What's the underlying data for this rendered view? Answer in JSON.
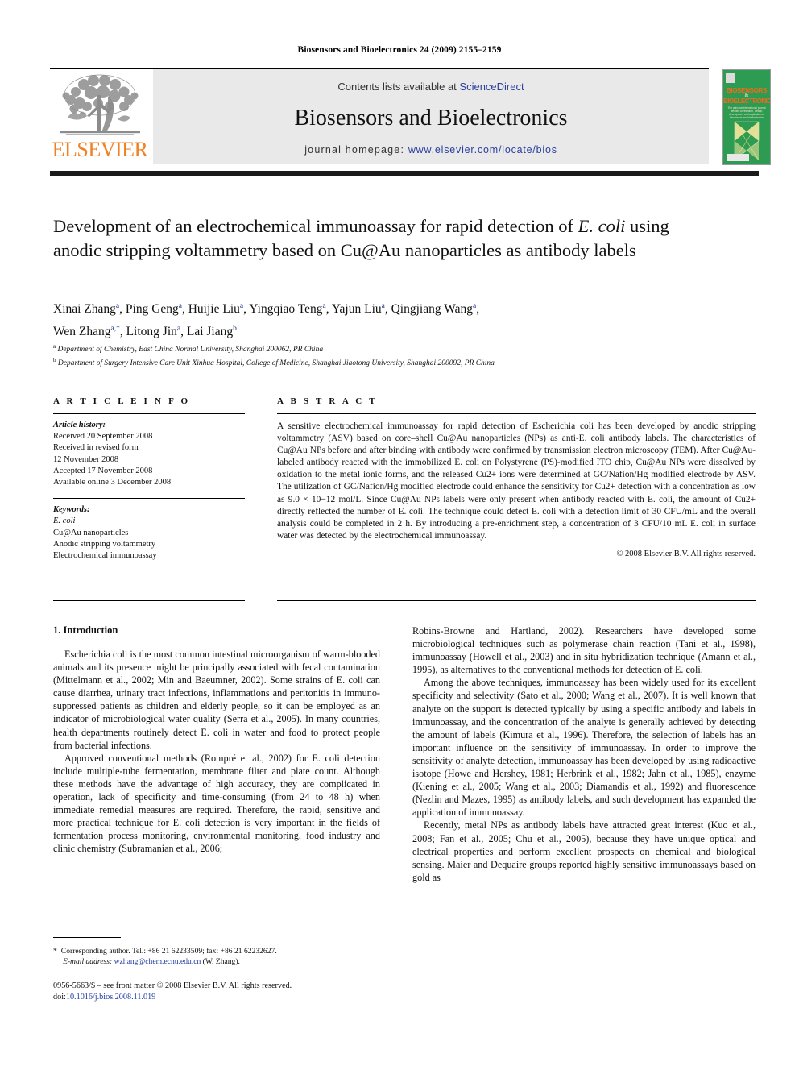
{
  "running_head": "Biosensors and Bioelectronics 24 (2009) 2155–2159",
  "journal_header": {
    "contents_prefix": "Contents lists available at ",
    "sciencedirect": "ScienceDirect",
    "journal_name": "Biosensors and Bioelectronics",
    "homepage_label": "journal homepage:",
    "homepage_url": "www.elsevier.com/locate/bios",
    "publisher_logo_text": "ELSEVIER",
    "cover": {
      "line1": "BIOSENSORS",
      "amp": "&",
      "line2": "BIOELECTRONICS",
      "subtitle": "The principal international journal devoted to research, design, development and application of biosensors and bioelectronics"
    },
    "accent_orange": "#f08020",
    "accent_blue": "#2b3f9e",
    "cover_green": "#2e9b52"
  },
  "article": {
    "title_line1": "Development of an electrochemical immunoassay for rapid detection of",
    "title_italic": "E. coli",
    "title_line2_rest": " using anodic stripping voltammetry based on Cu@Au nanoparticles",
    "title_line3": "as antibody labels",
    "authors": "Xinai Zhang, Ping Geng, Huijie Liu, Yingqiao Teng, Yajun Liu, Qingjiang Wang, Wen Zhang, Litong Jin, Lai Jiang",
    "author_list": [
      {
        "name": "Xinai Zhang",
        "sup": "a"
      },
      {
        "name": "Ping Geng",
        "sup": "a"
      },
      {
        "name": "Huijie Liu",
        "sup": "a"
      },
      {
        "name": "Yingqiao Teng",
        "sup": "a"
      },
      {
        "name": "Yajun Liu",
        "sup": "a"
      },
      {
        "name": "Qingjiang Wang",
        "sup": "a"
      },
      {
        "name": "Wen Zhang",
        "sup": "a,*"
      },
      {
        "name": "Litong Jin",
        "sup": "a"
      },
      {
        "name": "Lai Jiang",
        "sup": "b"
      }
    ],
    "affiliations": [
      {
        "mark": "a",
        "text": "Department of Chemistry, East China Normal University, Shanghai 200062, PR China"
      },
      {
        "mark": "b",
        "text": "Department of Surgery Intensive Care Unit Xinhua Hospital, College of Medicine, Shanghai Jiaotong University, Shanghai 200092, PR China"
      }
    ]
  },
  "article_info": {
    "heading": "A R T I C L E    I N F O",
    "history_label": "Article history:",
    "history_lines": [
      "Received 20 September 2008",
      "Received in revised form",
      "12 November 2008",
      "Accepted 17 November 2008",
      "Available online 3 December 2008"
    ],
    "keywords_label": "Keywords:",
    "keywords": [
      "E. coli",
      "Cu@Au nanoparticles",
      "Anodic stripping voltammetry",
      "Electrochemical immunoassay"
    ]
  },
  "abstract": {
    "heading": "A B S T R A C T",
    "text": "A sensitive electrochemical immunoassay for rapid detection of Escherichia coli has been developed by anodic stripping voltammetry (ASV) based on core–shell Cu@Au nanoparticles (NPs) as anti-E. coli antibody labels. The characteristics of Cu@Au NPs before and after binding with antibody were confirmed by transmission electron microscopy (TEM). After Cu@Au-labeled antibody reacted with the immobilized E. coli on Polystyrene (PS)-modified ITO chip, Cu@Au NPs were dissolved by oxidation to the metal ionic forms, and the released Cu2+ ions were determined at GC/Nafion/Hg modified electrode by ASV. The utilization of GC/Nafion/Hg modified electrode could enhance the sensitivity for Cu2+ detection with a concentration as low as 9.0 × 10−12 mol/L. Since Cu@Au NPs labels were only present when antibody reacted with E. coli, the amount of Cu2+ directly reflected the number of E. coli. The technique could detect E. coli with a detection limit of 30 CFU/mL and the overall analysis could be completed in 2 h. By introducing a pre-enrichment step, a concentration of 3 CFU/10 mL E. coli in surface water was detected by the electrochemical immunoassay.",
    "copyright": "© 2008 Elsevier B.V. All rights reserved."
  },
  "body": {
    "section_title": "1.  Introduction",
    "left_paragraphs": [
      "Escherichia coli is the most common intestinal microorganism of warm-blooded animals and its presence might be principally associated with fecal contamination (Mittelmann et al., 2002; Min and Baeumner, 2002). Some strains of E. coli can cause diarrhea, urinary tract infections, inflammations and peritonitis in immuno-suppressed patients as children and elderly people, so it can be employed as an indicator of microbiological water quality (Serra et al., 2005). In many countries, health departments routinely detect E. coli in water and food to protect people from bacterial infections.",
      "Approved conventional methods (Rompré et al., 2002) for E. coli detection include multiple-tube fermentation, membrane filter and plate count. Although these methods have the advantage of high accuracy, they are complicated in operation, lack of specificity and time-consuming (from 24 to 48 h) when immediate remedial measures are required. Therefore, the rapid, sensitive and more practical technique for E. coli detection is very important in the fields of fermentation process monitoring, environmental monitoring, food industry and clinic chemistry (Subramanian et al., 2006;"
    ],
    "right_paragraphs": [
      "Robins-Browne and Hartland, 2002). Researchers have developed some microbiological techniques such as polymerase chain reaction (Tani et al., 1998), immunoassay (Howell et al., 2003) and in situ hybridization technique (Amann et al., 1995), as alternatives to the conventional methods for detection of E. coli.",
      "Among the above techniques, immunoassay has been widely used for its excellent specificity and selectivity (Sato et al., 2000; Wang et al., 2007). It is well known that analyte on the support is detected typically by using a specific antibody and labels in immunoassay, and the concentration of the analyte is generally achieved by detecting the amount of labels (Kimura et al., 1996). Therefore, the selection of labels has an important influence on the sensitivity of immunoassay. In order to improve the sensitivity of analyte detection, immunoassay has been developed by using radioactive isotope (Howe and Hershey, 1981; Herbrink et al., 1982; Jahn et al., 1985), enzyme (Kiening et al., 2005; Wang et al., 2003; Diamandis et al., 1992) and fluorescence (Nezlin and Mazes, 1995) as antibody labels, and such development has expanded the application of immunoassay.",
      "Recently, metal NPs as antibody labels have attracted great interest (Kuo et al., 2008; Fan et al., 2005; Chu et al., 2005), because they have unique optical and electrical properties and perform excellent prospects on chemical and biological sensing. Maier and Dequaire groups reported highly sensitive immunoassays based on gold as"
    ]
  },
  "footnote": {
    "star": "*",
    "corresponding": "Corresponding author. Tel.: +86 21 62233509; fax: +86 21 62232627.",
    "email_label": "E-mail address:",
    "email": "wzhang@chem.ecnu.edu.cn",
    "email_suffix": " (W. Zhang)."
  },
  "imprint": {
    "line1": "0956-5663/$ – see front matter © 2008 Elsevier B.V. All rights reserved.",
    "doi_label": "doi:",
    "doi": "10.1016/j.bios.2008.11.019"
  }
}
